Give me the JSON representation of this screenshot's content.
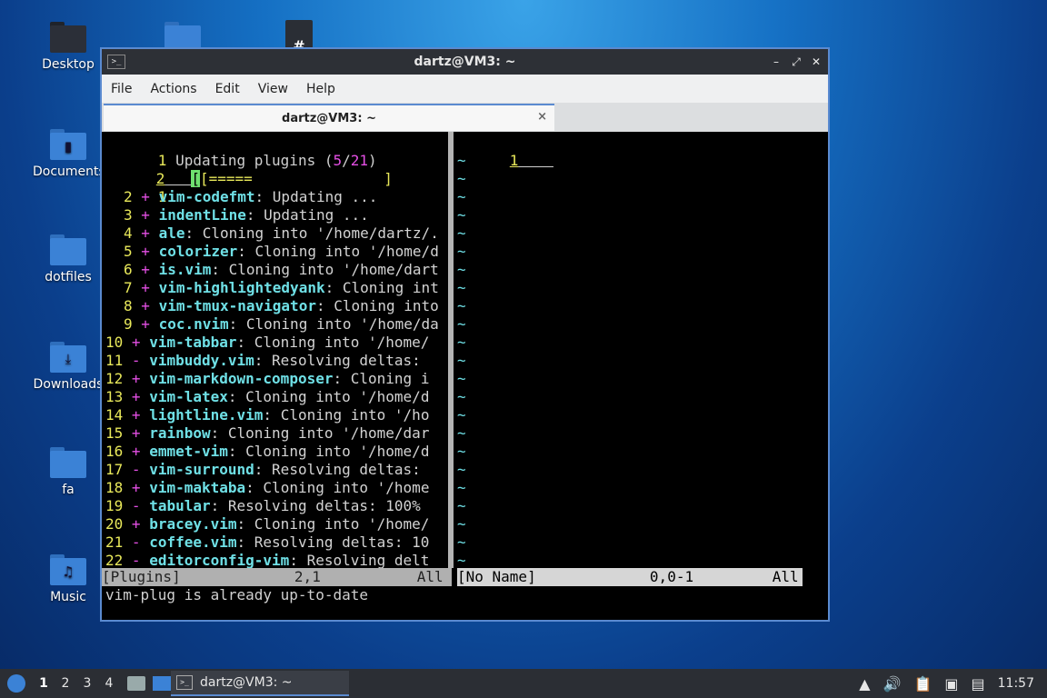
{
  "desktop": {
    "icons": [
      {
        "label": "Desktop"
      },
      {
        "label": "Documents"
      },
      {
        "label": "dotfiles"
      },
      {
        "label": "Downloads"
      },
      {
        "label": "fa"
      },
      {
        "label": "Music"
      }
    ]
  },
  "window": {
    "title": "dartz@VM3: ~",
    "menu": [
      "File",
      "Actions",
      "Edit",
      "View",
      "Help"
    ],
    "tab_title": "dartz@VM3: ~",
    "tab_close": "×"
  },
  "vim": {
    "header": {
      "num": "1",
      "text": "Updating plugins (",
      "done": "5",
      "sep": "/",
      "total": "21",
      "end": ")"
    },
    "line2": {
      "num": "2",
      "bar": "[=====",
      "bar_end": "]"
    },
    "line3": {
      "num": "1"
    },
    "plugins": [
      {
        "num": "2",
        "sign": "+",
        "name": "vim-codefmt",
        "msg": ": Updating ..."
      },
      {
        "num": "3",
        "sign": "+",
        "name": "indentLine",
        "msg": ": Updating ..."
      },
      {
        "num": "4",
        "sign": "+",
        "name": "ale",
        "msg": ": Cloning into '/home/dartz/."
      },
      {
        "num": "5",
        "sign": "+",
        "name": "colorizer",
        "msg": ": Cloning into '/home/d"
      },
      {
        "num": "6",
        "sign": "+",
        "name": "is.vim",
        "msg": ": Cloning into '/home/dart"
      },
      {
        "num": "7",
        "sign": "+",
        "name": "vim-highlightedyank",
        "msg": ": Cloning int"
      },
      {
        "num": "8",
        "sign": "+",
        "name": "vim-tmux-navigator",
        "msg": ": Cloning into"
      },
      {
        "num": "9",
        "sign": "+",
        "name": "coc.nvim",
        "msg": ": Cloning into '/home/da"
      },
      {
        "num": "10",
        "sign": "+",
        "name": "vim-tabbar",
        "msg": ": Cloning into '/home/"
      },
      {
        "num": "11",
        "sign": "-",
        "name": "vimbuddy.vim",
        "msg": ": Resolving deltas: "
      },
      {
        "num": "12",
        "sign": "+",
        "name": "vim-markdown-composer",
        "msg": ": Cloning i"
      },
      {
        "num": "13",
        "sign": "+",
        "name": "vim-latex",
        "msg": ": Cloning into '/home/d"
      },
      {
        "num": "14",
        "sign": "+",
        "name": "lightline.vim",
        "msg": ": Cloning into '/ho"
      },
      {
        "num": "15",
        "sign": "+",
        "name": "rainbow",
        "msg": ": Cloning into '/home/dar"
      },
      {
        "num": "16",
        "sign": "+",
        "name": "emmet-vim",
        "msg": ": Cloning into '/home/d"
      },
      {
        "num": "17",
        "sign": "-",
        "name": "vim-surround",
        "msg": ": Resolving deltas: "
      },
      {
        "num": "18",
        "sign": "+",
        "name": "vim-maktaba",
        "msg": ": Cloning into '/home"
      },
      {
        "num": "19",
        "sign": "-",
        "name": "tabular",
        "msg": ": Resolving deltas: 100%"
      },
      {
        "num": "20",
        "sign": "+",
        "name": "bracey.vim",
        "msg": ": Cloning into '/home/"
      },
      {
        "num": "21",
        "sign": "-",
        "name": "coffee.vim",
        "msg": ": Resolving deltas: 10"
      },
      {
        "num": "22",
        "sign": "-",
        "name": "editorconfig-vim",
        "msg": ": Resolving delt"
      }
    ],
    "right_first": "1",
    "tilde": "~",
    "status_left": "[Plugins]             2,1           All",
    "status_right": "[No Name]             0,0-1         All",
    "cmdline": "vim-plug is already up-to-date"
  },
  "taskbar": {
    "workspaces": [
      "1",
      "2",
      "3",
      "4"
    ],
    "task_label": "dartz@VM3: ~",
    "clock": "11:57"
  }
}
